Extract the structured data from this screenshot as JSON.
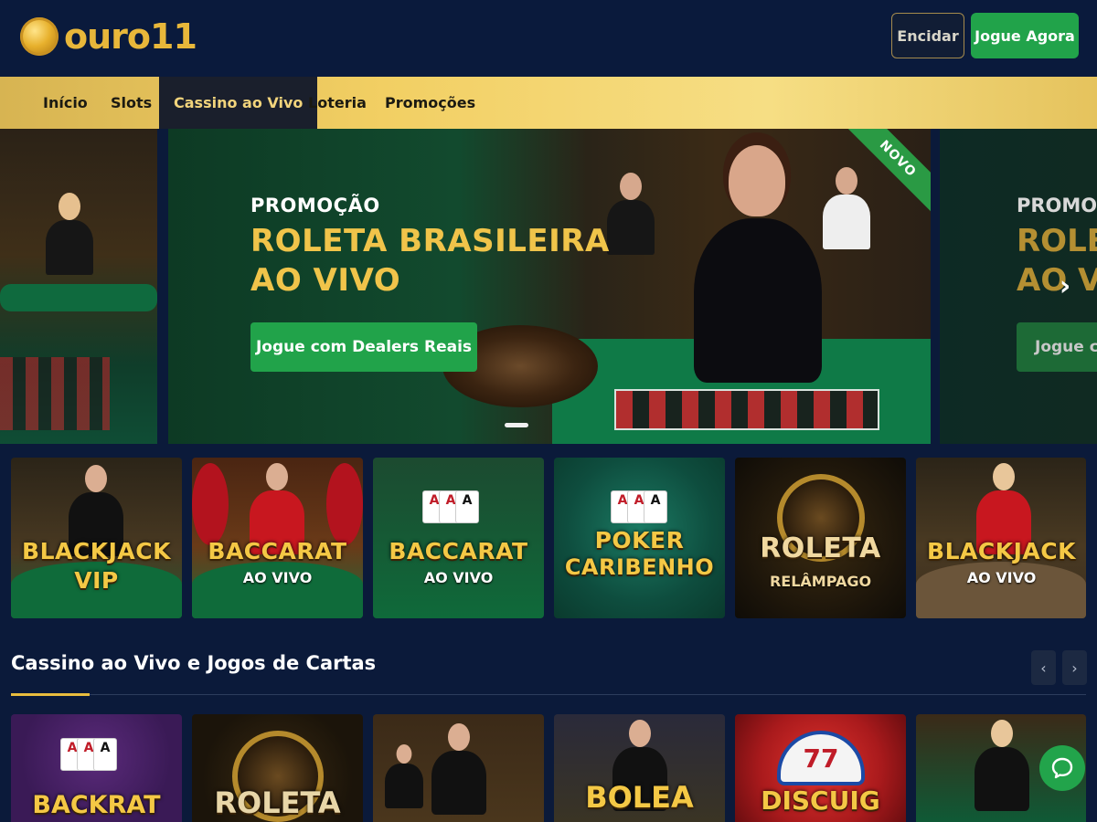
{
  "header": {
    "logo_text": "ouro11",
    "login_label": "Encidar",
    "signup_label": "Jogue Agora"
  },
  "nav": {
    "items": [
      "Início",
      "Slots",
      "Cassino ao Vivo",
      "Loteria",
      "Promoções"
    ],
    "active": "Cassino ao Vivo"
  },
  "hero": {
    "kicker": "PROMOÇÃO",
    "title_line1": "ROLETA BRASILEIRA",
    "title_line2": "AO VIVO",
    "cta": "Jogue com Dealers Reais",
    "ribbon": "NOVO",
    "next_slide": {
      "kicker": "PROMOÇ",
      "title_line1": "ROLET",
      "title_line2": "AO VI",
      "cta": "Jogue co"
    }
  },
  "featured_games": [
    {
      "name": "BLACKJACK",
      "sub": "VIP"
    },
    {
      "name": "BACCARAT",
      "sub": "AO VIVO"
    },
    {
      "name": "BACCARAT",
      "sub": "AO VIVO"
    },
    {
      "name": "POKER",
      "sub": "CARIBENHO"
    },
    {
      "name": "ROLETA",
      "sub": "RELÂMPAGO"
    },
    {
      "name": "BLACKJACK",
      "sub": "AO VIVO"
    }
  ],
  "section": {
    "title": "Cassino ao Vivo e Jogos de Cartas",
    "prev_icon": "‹",
    "next_icon": "›"
  },
  "section_games": [
    "BACKRAT",
    "ROLETA",
    "",
    "BOLEA",
    "DISCUIG",
    ""
  ],
  "colors": {
    "background": "#0b1a3a",
    "accent_gold": "#f0c44a",
    "accent_green": "#21a34a"
  },
  "icons": {
    "next_arrow": "›",
    "chat": "chat-icon"
  }
}
